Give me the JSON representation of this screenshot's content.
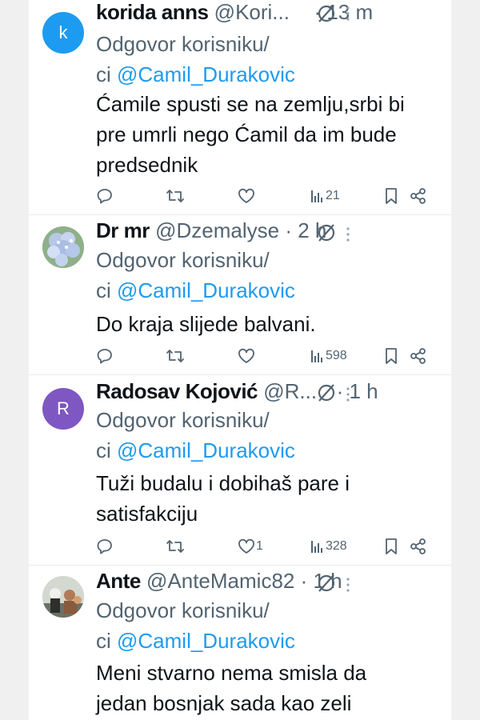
{
  "tweets": [
    {
      "name": "korida anns",
      "handle": "@Kori...",
      "time": "· 13 m",
      "reply_to": "Odgovor korisniku/",
      "reply_prefix": "ci ",
      "mention": "@Camil_Durakovic",
      "lines": [
        "Ćamile spusti se na zemlju,srbi bi",
        "pre umrli nego Ćamil da im bude",
        "predsednik"
      ],
      "avatar_letter": "k",
      "avatar_color": "#1d9bf0",
      "likes": "",
      "views": "21"
    },
    {
      "name": "Dr mr",
      "handle": "@Dzemalyse",
      "time": "· 2 h",
      "reply_to": "Odgovor korisniku/",
      "reply_prefix": "ci ",
      "mention": "@Camil_Durakovic",
      "lines": [
        "Do kraja slijede balvani."
      ],
      "avatar_image": "flower",
      "likes": "",
      "views": "598"
    },
    {
      "name": "Radosav Kojović",
      "handle": "@R...",
      "time": "· 1 h",
      "reply_to": "Odgovor korisniku/",
      "reply_prefix": "ci ",
      "mention": "@Camil_Durakovic",
      "lines": [
        "Tuži budalu i dobihaš pare i",
        "satisfakciju"
      ],
      "avatar_letter": "R",
      "avatar_color": "#7e57c2",
      "likes": "1",
      "views": "328"
    },
    {
      "name": "Ante",
      "handle": "@AnteMamic82",
      "time": "· 1 h",
      "reply_to": "Odgovor korisniku/",
      "reply_prefix": "ci ",
      "mention": "@Camil_Durakovic",
      "lines": [
        "Meni stvarno nema smisla da",
        "jedan bosnjak sada kao zeli"
      ],
      "avatar_image": "photo"
    }
  ],
  "icons": {
    "reply": "reply-icon",
    "retweet": "retweet-icon",
    "like": "heart-icon",
    "views": "views-icon",
    "bookmark": "bookmark-icon",
    "share": "share-icon",
    "mute": "mute-icon",
    "more": "more-icon"
  },
  "colors": {
    "mention": "#1d9bf0",
    "secondary": "#536471",
    "text": "#0f1419"
  }
}
